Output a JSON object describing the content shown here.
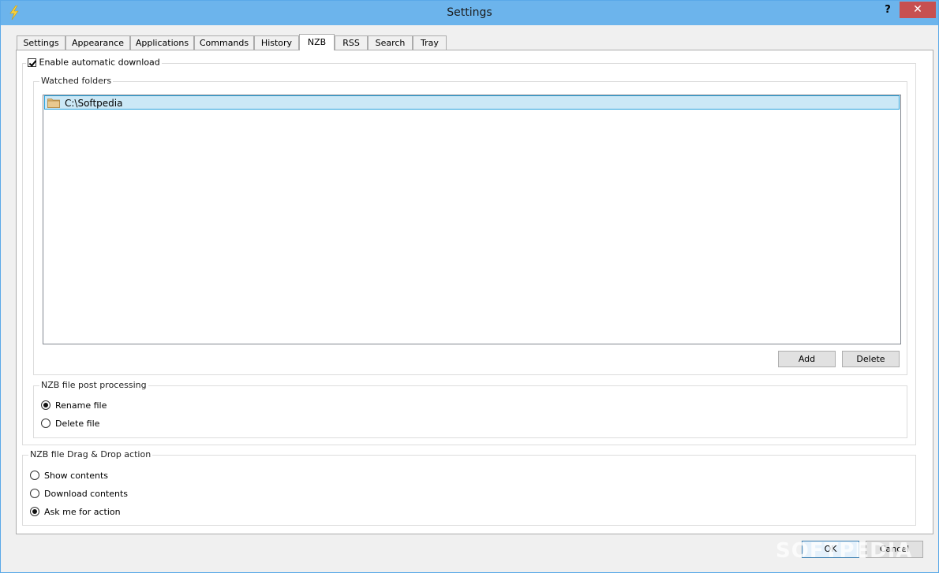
{
  "window": {
    "title": "Settings",
    "help_label": "?",
    "close_label": "✕"
  },
  "tabs": [
    {
      "label": "Settings"
    },
    {
      "label": "Appearance"
    },
    {
      "label": "Applications"
    },
    {
      "label": "Commands"
    },
    {
      "label": "History"
    },
    {
      "label": "NZB"
    },
    {
      "label": "RSS"
    },
    {
      "label": "Search"
    },
    {
      "label": "Tray"
    }
  ],
  "active_tab": "NZB",
  "auto_download": {
    "label": "Enable automatic download",
    "checked": true
  },
  "watched_folders": {
    "title": "Watched folders",
    "items": [
      {
        "label": "C:\\Softpedia",
        "icon": "folder-icon",
        "selected": true
      }
    ],
    "add_label": "Add",
    "delete_label": "Delete"
  },
  "post_processing": {
    "title": "NZB file post processing",
    "options": [
      {
        "label": "Rename file",
        "selected": true
      },
      {
        "label": "Delete file",
        "selected": false
      }
    ]
  },
  "drag_drop": {
    "title": "NZB file Drag & Drop action",
    "options": [
      {
        "label": "Show contents",
        "selected": false
      },
      {
        "label": "Download contents",
        "selected": false
      },
      {
        "label": "Ask me for action",
        "selected": true
      }
    ]
  },
  "footer": {
    "ok_label": "OK",
    "cancel_label": "Cancel"
  },
  "watermark": "SOFTPEDIA",
  "colors": {
    "titlebar": "#6cb4ec",
    "close_button": "#c75050",
    "selection": "#cbe8f6",
    "selection_border": "#26a0da"
  }
}
